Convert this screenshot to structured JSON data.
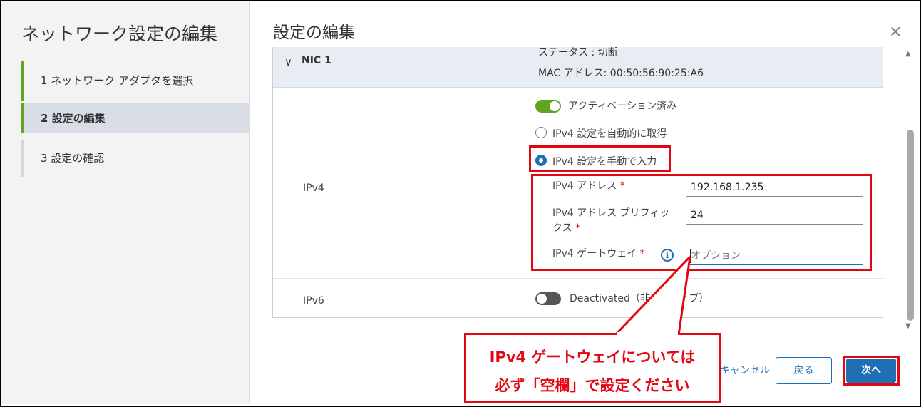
{
  "wizard": {
    "title": "ネットワーク設定の編集",
    "steps": [
      {
        "label": "1  ネットワーク アダプタを選択"
      },
      {
        "label": "2  設定の編集"
      },
      {
        "label": "3  設定の確認"
      }
    ]
  },
  "main": {
    "title": "設定の編集",
    "close_glyph": "×"
  },
  "nic": {
    "chevron": "∨",
    "name": "NIC 1",
    "status": "ステータス : 切断",
    "mac": "MAC アドレス: 00:50:56:90:25:A6"
  },
  "ipv4": {
    "label": "IPv4",
    "activation_label": "アクティベーション済み",
    "auto_label": "IPv4 設定を自動的に取得",
    "manual_label": "IPv4 設定を手動で入力",
    "address_label": "IPv4 アドレス",
    "address_value": "192.168.1.235",
    "prefix_label_line1": "IPv4 アドレス プリフィッ",
    "prefix_label_line2": "クス",
    "prefix_value": "24",
    "gateway_label": "IPv4 ゲートウェイ",
    "gateway_placeholder": "オプション",
    "required_mark": "*",
    "info_glyph": "i"
  },
  "ipv6": {
    "label": "IPv6",
    "status_label": "Deactivated（非アクティブ）"
  },
  "buttons": {
    "cancel": "キャンセル",
    "back": "戻る",
    "next": "次へ"
  },
  "callout": {
    "line1": "IPv4 ゲートウェイについては",
    "line2": "必ず「空欄」で設定ください"
  },
  "scroll": {
    "up_glyph": "▲",
    "down_glyph": "▼"
  },
  "colors": {
    "accent": "#1f6fb4",
    "toggle_on": "#62a420",
    "annotation_red": "#e30613"
  }
}
